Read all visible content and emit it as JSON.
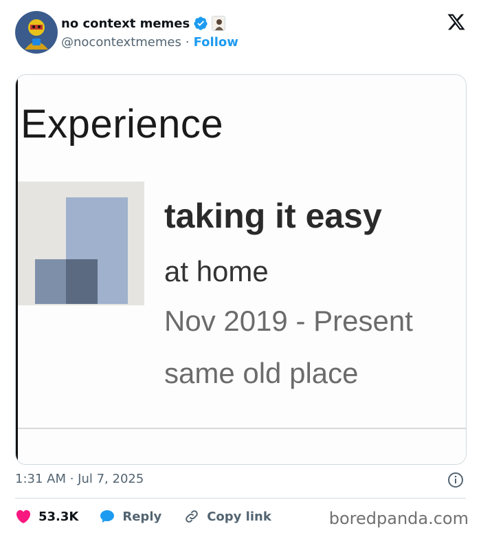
{
  "tweet": {
    "display_name": "no context memes",
    "handle": "@nocontextmemes",
    "separator": "·",
    "follow_label": "Follow",
    "timestamp": "1:31 AM · Jul 7, 2025"
  },
  "media": {
    "section_title": "Experience",
    "job_title": "taking it easy",
    "company": "at home",
    "dates": "Nov 2019 - Present",
    "location": "same old place"
  },
  "actions": {
    "likes": "53.3K",
    "reply_label": "Reply",
    "copy_link_label": "Copy link"
  },
  "watermark": "boredpanda.com",
  "colors": {
    "accent": "#1d9bf0",
    "like": "#f91880",
    "text_secondary": "#536471"
  },
  "icons": [
    "verified-badge-icon",
    "x-logo-icon",
    "info-icon",
    "heart-icon",
    "reply-icon",
    "link-icon"
  ]
}
